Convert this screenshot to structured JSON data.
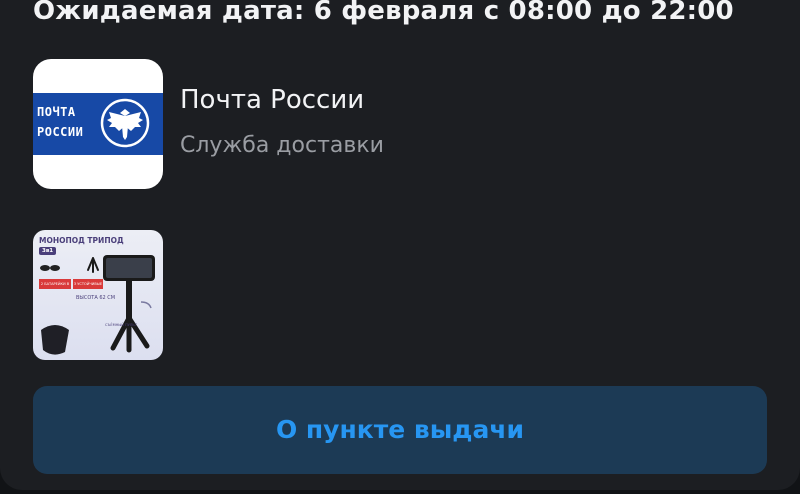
{
  "delivery": {
    "expected_date": "Ожидаемая дата: 6 февраля с 08:00 до 22:00"
  },
  "service": {
    "logo_icon": "russian-post-logo",
    "logo_lines": [
      "ПОЧТА",
      "РОССИИ"
    ],
    "name": "Почта России",
    "subtitle": "Служба доставки"
  },
  "product": {
    "thumbnail_icon": "monopod-tripod-product-image",
    "thumb_title": "МОНОПОД ТРИПОД",
    "thumb_badge": "3в1",
    "thumb_tag_1": "2 БАТАРЕЙКИ В КОМПЛЕКТЕ",
    "thumb_tag_2": "3 УСТОЙЧИВЫЕ НОЖКИ",
    "thumb_height": "ВЫСОТА 62 СМ",
    "thumb_remote": "СЪЁМНЫЙ ПУЛЬТ"
  },
  "actions": {
    "pickup_point_label": "О пункте выдачи"
  },
  "colors": {
    "background": "#1c1e22",
    "button_background": "#1c3a55",
    "button_text": "#2796f2",
    "logo_blue": "#1749a6"
  }
}
